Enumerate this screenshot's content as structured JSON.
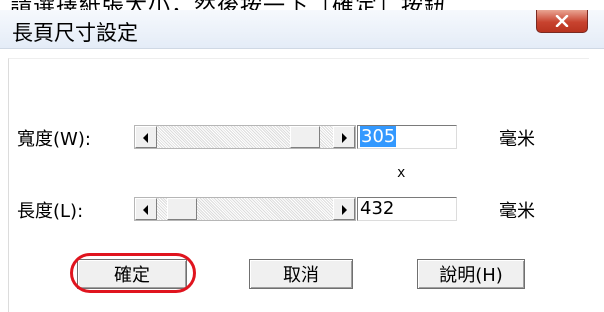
{
  "top_strip_text": "請選擇紙張大小，然後按一下［確定］按鈕",
  "window": {
    "title": "長頁尺寸設定"
  },
  "width_row": {
    "label": "寬度(W):",
    "value": "305",
    "unit": "毫米",
    "slider_fraction": 0.76
  },
  "separator": "x",
  "length_row": {
    "label": "長度(L):",
    "value": "432",
    "unit": "毫米",
    "slider_fraction": 0.16
  },
  "buttons": {
    "ok": "確定",
    "cancel": "取消",
    "help": "說明(H)"
  },
  "colors": {
    "selection": "#3399ff",
    "close_button": "#c8432f",
    "highlight_ring": "#e0141e"
  }
}
